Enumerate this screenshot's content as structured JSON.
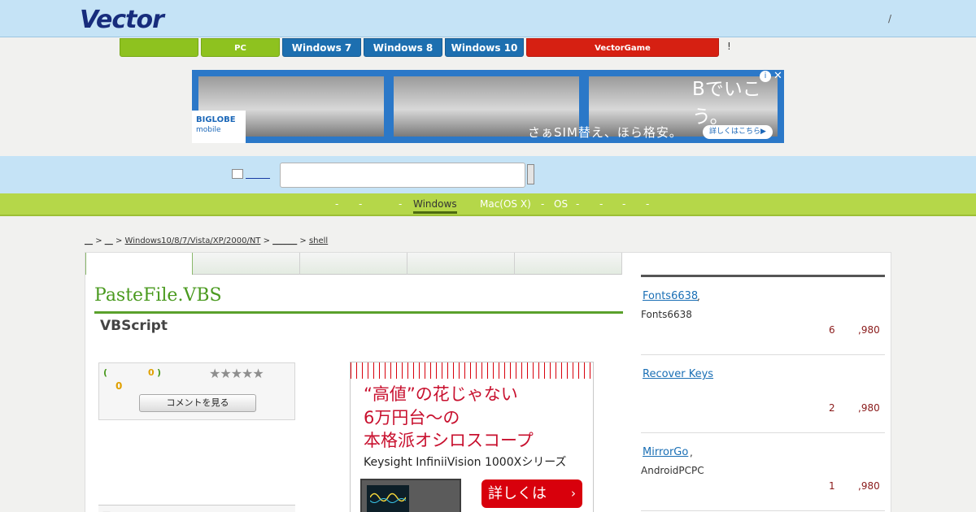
{
  "header": {
    "logo_text": "Vector",
    "right_text": "/"
  },
  "nav": {
    "tabs": [
      {
        "label": "",
        "color": "#8ec21f"
      },
      {
        "label": "PC",
        "color": "#8ec21f"
      },
      {
        "label": "Windows 7",
        "color": "#1d6fb0"
      },
      {
        "label": "Windows 8",
        "color": "#1d6fb0"
      },
      {
        "label": "Windows 10",
        "color": "#1d6fb0"
      },
      {
        "label": "VectorGame",
        "color": "#d62012"
      }
    ],
    "exclaim": "!"
  },
  "top_ad": {
    "headline": "Bでいこう。",
    "sub": "さぁSIM替え、ほら格安。",
    "cta": "詳しくはこちら▶",
    "brand": "BIGLOBE",
    "brand_sub": "mobile",
    "info_icon": "info-icon",
    "close_icon": "close-icon"
  },
  "search": {
    "placeholder": "",
    "link_text": ""
  },
  "categories": [
    {
      "label": "-"
    },
    {
      "label": "-"
    },
    {
      "label": "-"
    },
    {
      "label": "Windows",
      "active": true
    },
    {
      "label": "Mac(OS X)"
    },
    {
      "label": "-"
    },
    {
      "label": "OS"
    },
    {
      "label": "-"
    },
    {
      "label": "-"
    },
    {
      "label": "-"
    },
    {
      "label": "-"
    },
    {
      "label": "-"
    }
  ],
  "breadcrumb": {
    "items": [
      "__",
      ">",
      "__",
      ">",
      "Windows10/8/7/Vista/XP/2000/NT",
      ">",
      "______",
      ">",
      "shell"
    ]
  },
  "product": {
    "title": "PasteFile.VBS",
    "subtitle": "VBScript",
    "rating": {
      "open_paren": "(",
      "count": "0",
      "close_paren": ")",
      "score": "0",
      "stars": "★★★★★",
      "stars_filled": 0,
      "comment_button": "コメントを見る"
    },
    "lower_box": "—"
  },
  "side_ad": {
    "lines": [
      "“高値”の花じゃない",
      "6万円台～の",
      "本格派オシロスコープ"
    ],
    "english": "Keysight InfiniiVision 1000Xシリーズ",
    "cta": "詳しくは",
    "cta_arrow": "›"
  },
  "ranking": [
    {
      "name": "Fonts6638",
      "comma": ",",
      "desc": "Fonts6638",
      "count": "6",
      "price": ",980"
    },
    {
      "name": "Recover Keys",
      "comma": "",
      "desc": "",
      "count": "2",
      "price": ",980"
    },
    {
      "name": "MirrorGo",
      "comma": ",",
      "desc": "AndroidPCPC",
      "count": "1",
      "price": ",980"
    }
  ]
}
